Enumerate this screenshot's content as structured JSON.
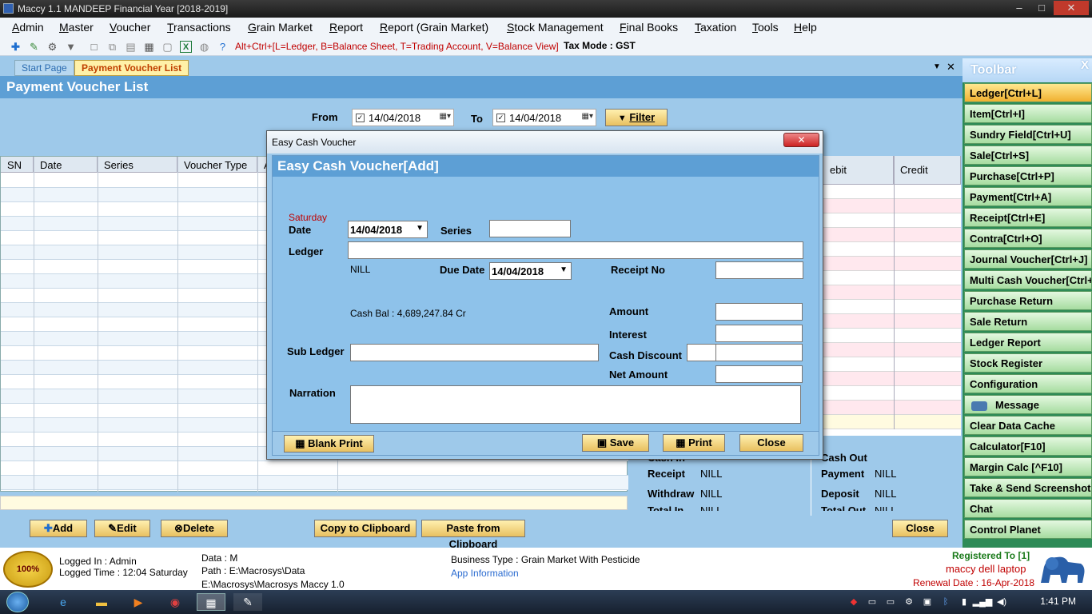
{
  "window": {
    "title": "Maccy 1.1 MANDEEP Financial Year [2018-2019]",
    "min": "–",
    "max": "□",
    "close": "✕"
  },
  "menu": [
    "Admin",
    "Master",
    "Voucher",
    "Transactions",
    "Grain Market",
    "Report",
    "Report (Grain Market)",
    "Stock Management",
    "Final Books",
    "Taxation",
    "Tools",
    "Help"
  ],
  "toolbar": {
    "shortcut_hint": "Alt+Ctrl+[L=Ledger, B=Balance Sheet, T=Trading Account, V=Balance View]",
    "tax_mode": "Tax Mode : GST"
  },
  "tabs": {
    "start": "Start Page",
    "active": "Payment Voucher List"
  },
  "page": {
    "title": "Payment Voucher List",
    "from_label": "From",
    "from_date": "14/04/2018",
    "to_label": "To",
    "to_date": "14/04/2018",
    "filter_label": "Filter",
    "columns": [
      "SN",
      "Date",
      "Series",
      "Voucher Type",
      "A"
    ],
    "right_columns": [
      "ebit",
      "Credit"
    ],
    "summary": {
      "cash_in": "Cash In",
      "receipt_label": "Receipt",
      "receipt_value": "NILL",
      "withdraw_label": "Withdraw",
      "withdraw_value": "NILL",
      "total_in": "Total In",
      "total_in_value": "NILL",
      "cash_out": "Cash Out",
      "payment_label": "Payment",
      "payment_value": "NILL",
      "deposit_label": "Deposit",
      "deposit_value": "NILL",
      "total_out": "Total Out",
      "total_out_value": "NILL"
    },
    "buttons": {
      "add": "Add",
      "edit": "Edit",
      "delete": "Delete",
      "copy": "Copy to Clipboard",
      "paste": "Paste from Clipboard",
      "close": "Close"
    }
  },
  "dialog": {
    "window_title": "Easy Cash Voucher",
    "close_glyph": "✕",
    "heading": "Easy Cash Voucher[Add]",
    "day": "Saturday",
    "date_label": "Date",
    "date_value": "14/04/2018",
    "series_label": "Series",
    "ledger_label": "Ledger",
    "ledger_balance": "NILL",
    "due_date_label": "Due Date",
    "due_date_value": "14/04/2018",
    "receipt_no_label": "Receipt No",
    "cash_bal": "Cash Bal : 4,689,247.84 Cr",
    "amount_label": "Amount",
    "interest_label": "Interest",
    "sub_ledger_label": "Sub Ledger",
    "cash_discount_label": "Cash Discount",
    "net_amount_label": "Net Amount",
    "narration_label": "Narration",
    "buttons": {
      "blank_print": "Blank Print",
      "save": "Save",
      "print": "Print",
      "close": "Close"
    }
  },
  "sidebar": {
    "title": "Toolbar",
    "close": "X",
    "items": [
      "Ledger[Ctrl+L]",
      "Item[Ctrl+I]",
      "Sundry Field[Ctrl+U]",
      "Sale[Ctrl+S]",
      "Purchase[Ctrl+P]",
      "Payment[Ctrl+A]",
      "Receipt[Ctrl+E]",
      "Contra[Ctrl+O]",
      "Journal Voucher[Ctrl+J]",
      "Multi Cash Voucher[Ctrl+",
      "Purchase Return",
      "Sale Return",
      "Ledger Report",
      "Stock Register",
      "Configuration",
      "Message",
      "Clear Data Cache",
      "Calculator[F10]",
      "Margin Calc [^F10]",
      "Take & Send Screenshot",
      "Chat",
      "Control Planet"
    ]
  },
  "status": {
    "seal": "100%",
    "logged_in": "Logged In : Admin",
    "logged_time": "Logged Time : 12:04 Saturday",
    "data": "Data : M",
    "path": "Path : E:\\Macrosys\\Data",
    "exe_path": "E:\\Macrosys\\Macrosys Maccy 1.0",
    "business_type": "Business Type : Grain Market With Pesticide",
    "app_info": "App Information",
    "registered": "Registered To [1]",
    "machine": "maccy dell laptop",
    "renewal": "Renewal Date : 16-Apr-2018"
  },
  "taskbar": {
    "time": "1:41 PM"
  }
}
